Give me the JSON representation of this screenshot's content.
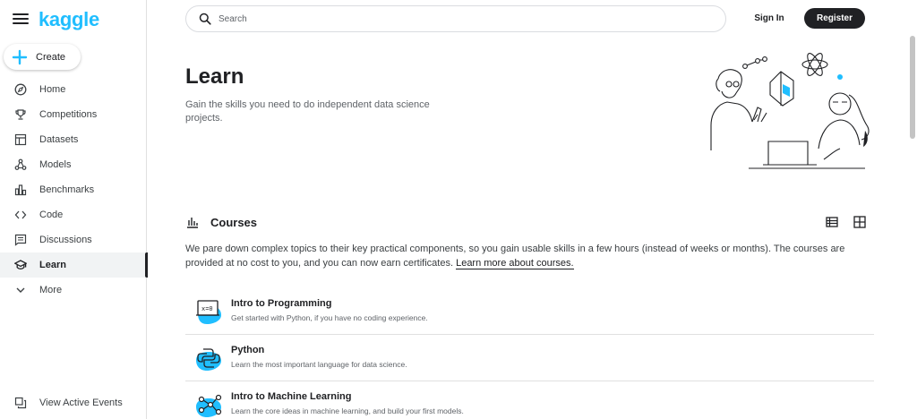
{
  "brand": {
    "logo": "kaggle",
    "accent": "#20beff"
  },
  "sidebar": {
    "create_label": "Create",
    "items": [
      {
        "label": "Home",
        "icon": "compass-icon"
      },
      {
        "label": "Competitions",
        "icon": "trophy-icon"
      },
      {
        "label": "Datasets",
        "icon": "table-icon"
      },
      {
        "label": "Models",
        "icon": "models-icon"
      },
      {
        "label": "Benchmarks",
        "icon": "bar-chart-icon"
      },
      {
        "label": "Code",
        "icon": "code-icon"
      },
      {
        "label": "Discussions",
        "icon": "comments-icon"
      },
      {
        "label": "Learn",
        "icon": "graduation-cap-icon",
        "active": true
      },
      {
        "label": "More",
        "icon": "chevron-down-icon"
      }
    ],
    "events_label": "View Active Events"
  },
  "topbar": {
    "search_placeholder": "Search",
    "signin_label": "Sign In",
    "register_label": "Register"
  },
  "main": {
    "title": "Learn",
    "subtitle": "Gain the skills you need to do independent data science projects.",
    "courses_heading": "Courses",
    "description": "We pare down complex topics to their key practical components, so you gain usable skills in a few hours (instead of weeks or months). The courses are provided at no cost to you, and you can now earn certificates. ",
    "description_link": "Learn more about courses.",
    "courses": [
      {
        "title": "Intro to Programming",
        "desc": "Get started with Python, if you have no coding experience.",
        "icon": "programming-icon"
      },
      {
        "title": "Python",
        "desc": "Learn the most important language for data science.",
        "icon": "python-icon"
      },
      {
        "title": "Intro to Machine Learning",
        "desc": "Learn the core ideas in machine learning, and build your first models.",
        "icon": "machine-learning-icon"
      }
    ]
  }
}
